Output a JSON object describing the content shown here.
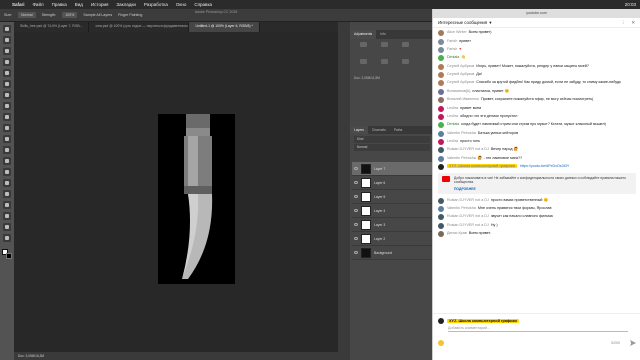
{
  "menubar": {
    "apple": "",
    "items": [
      "Safari",
      "Файл",
      "Правка",
      "Вид",
      "История",
      "Закладки",
      "Разработка",
      "Окно",
      "Справка"
    ],
    "clock": "20:03",
    "url": "youtube.com"
  },
  "photoshop": {
    "title": "Adobe Photoshop CC 2018",
    "options": [
      "Size:",
      "Normal",
      "Strength:",
      "100%",
      "Sample All Layers",
      "Finger Painting"
    ],
    "tabs": [
      "Skills_tree.psd @ 74,6% (Layer 7, RGB...",
      "cma.psd @ 100% (суть отдых — научиться фундаментальным основ...",
      "Untitled-1 @ 100% (Layer 6, RGB/8) *"
    ],
    "docinfo": "Doc: 2,00M/11,5M",
    "statusbar": "Doc: 3,00M/16,3M",
    "panel_tabs": [
      "Adjustments",
      "Info"
    ],
    "layer_tabs": [
      "Layers",
      "Channels",
      "Paths"
    ],
    "layer_kind": "Kind",
    "layer_mode": "Normal",
    "opacity": "Opacity: 100%",
    "fill": "Fill: 100%",
    "layers": [
      "Layer 7",
      "Layer 6",
      "Layer 5",
      "Layer 4",
      "Layer 3",
      "Layer 2",
      "Background"
    ]
  },
  "chat": {
    "title": "Интересные сообщения",
    "messages": [
      {
        "author": "Alice Winter",
        "text": "Всем привет)"
      },
      {
        "author": "Farish",
        "text": "привет"
      },
      {
        "author": "Farish",
        "text": "♥"
      },
      {
        "author": "Dimiala",
        "text": "👋"
      },
      {
        "author": "Сергей Арбузов",
        "text": "Игорь, привет! Может, пожалуйста, рендер у папки защиты моей?"
      },
      {
        "author": "Сергей Арбузов",
        "text": "Да!"
      },
      {
        "author": "Сергей Арбузов",
        "text": "Спасибо за крутой фидбек! Как приду домой, если не забуду, то сниму какие-нибудь"
      },
      {
        "author": "Витаминов[А]",
        "text": "пластинка, привет 😊"
      },
      {
        "author": "Виталий Иваненко",
        "text": "Привет, сохраните пожалуйста эфир, не могу сейчас посмотреть("
      },
      {
        "author": "Leolira",
        "text": "привет всем"
      },
      {
        "author": "Leolira",
        "text": "обидно что эти делики пропустил"
      },
      {
        "author": "Dimiala",
        "text": "когда будет ламповый стрим или стрим про музыт? Кстати, музыт классный вышел)"
      },
      {
        "author": "Valentin Petrusha",
        "text": "Батька умных кейторов"
      },
      {
        "author": "Leolira",
        "text": "просто гонь"
      },
      {
        "author": "Ruslan DJYVER not a DJ",
        "text": "Вечер народ 🙋"
      },
      {
        "author": "Valentin Petrusha",
        "text": "🙋 - это ламповое мага??"
      },
      {
        "author": "XYZ. Школа компьютерной графики",
        "text": "https://youtu.be/dPxDxOs3t3Y"
      }
    ],
    "notice": {
      "text": "Добро пожаловать в чат! Не забывайте о конфиденциальности своих данных и соблюдайте правила нашего сообщества.",
      "link": "ПОДРОБНЕЕ"
    },
    "messages2": [
      {
        "author": "Ruslan DJYVER not a DJ",
        "text": "просто взмах приветственный 😊"
      },
      {
        "author": "Valentin Petrusha",
        "text": "Мне очень нравятся твои формы, Ярослав"
      },
      {
        "author": "Ruslan DJYVER not a DJ",
        "text": "звучит как начало славного фильма"
      },
      {
        "author": "Ruslan DJYVER not a DJ",
        "text": "Ну )"
      },
      {
        "author": "Денис Крав",
        "text": "Всем привет."
      }
    ],
    "compose": {
      "author": "XYZ. Школа компьютерной графики",
      "placeholder": "Добавить комментарий...",
      "counter": "0/200"
    }
  },
  "colors": {
    "accent": "#ffd600",
    "link": "#1565c0"
  }
}
